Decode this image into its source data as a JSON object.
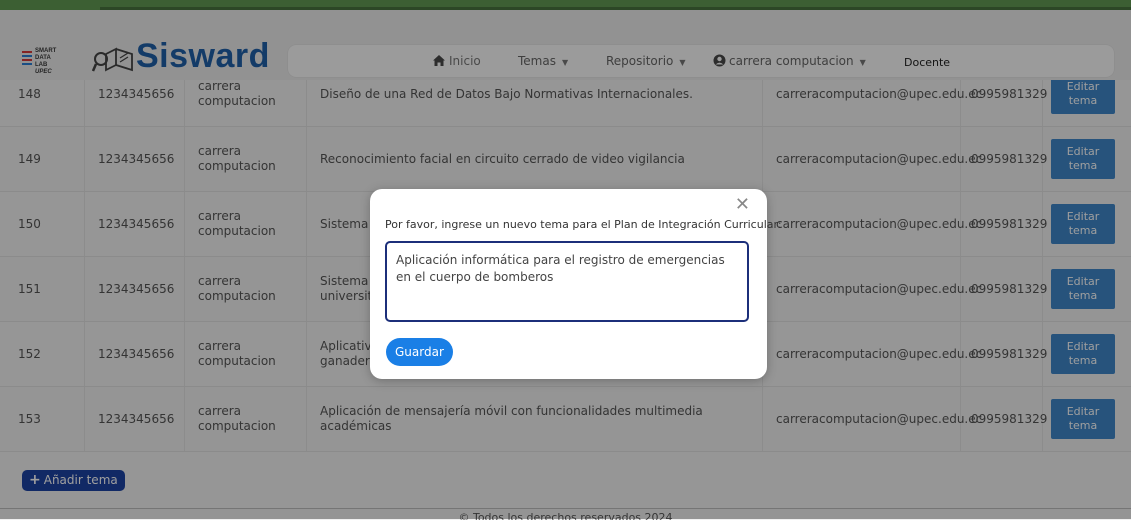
{
  "brand": {
    "logo_text_lines": [
      "SMART",
      "DATA LAB",
      "UPEC"
    ],
    "title": "Sisward"
  },
  "nav": {
    "home": "Inicio",
    "temas": "Temas",
    "repositorio": "Repositorio",
    "user": "carrera computacion",
    "role": "Docente",
    "icons": {
      "home": "home-icon",
      "user": "user-circle-icon",
      "dropdown": "caret-down-icon"
    }
  },
  "table": {
    "rows": [
      {
        "id": "148",
        "cedula": "1234345656",
        "carrera": "carrera computacion",
        "tema": "Diseño de una Red de Datos Bajo Normativas Internacionales.",
        "email": "carreracomputacion@upec.edu.ec",
        "telefono": "0995981329",
        "action": "Editar tema"
      },
      {
        "id": "149",
        "cedula": "1234345656",
        "carrera": "carrera computacion",
        "tema": "Reconocimiento facial en circuito cerrado de video vigilancia",
        "email": "carreracomputacion@upec.edu.ec",
        "telefono": "0995981329",
        "action": "Editar tema"
      },
      {
        "id": "150",
        "cedula": "1234345656",
        "carrera": "carrera computacion",
        "tema": "Sistema i",
        "email": "carreracomputacion@upec.edu.ec",
        "telefono": "0995981329",
        "action": "Editar tema"
      },
      {
        "id": "151",
        "cedula": "1234345656",
        "carrera": "carrera computacion",
        "tema": "Sistema i\nuniversita",
        "email": "carreracomputacion@upec.edu.ec",
        "telefono": "0995981329",
        "action": "Editar tema"
      },
      {
        "id": "152",
        "cedula": "1234345656",
        "carrera": "carrera computacion",
        "tema": "Aplicativo\nganadera",
        "email": "carreracomputacion@upec.edu.ec",
        "telefono": "0995981329",
        "action": "Editar tema"
      },
      {
        "id": "153",
        "cedula": "1234345656",
        "carrera": "carrera computacion",
        "tema": "Aplicación de mensajería móvil con funcionalidades multimedia académicas",
        "email": "carreracomputacion@upec.edu.ec",
        "telefono": "0995981329",
        "action": "Editar tema"
      }
    ],
    "add_button": "Añadir tema"
  },
  "footer": {
    "text": "© Todos los derechos reservados 2024"
  },
  "modal": {
    "label": "Por favor, ingrese un nuevo tema para el Plan de Integración Curricular:",
    "value": "Aplicación informática para el registro de emergencias en el cuerpo de bomberos",
    "save_button": "Guardar",
    "close_icon": "close-icon"
  },
  "colors": {
    "brand_blue": "#1f5fa8",
    "edit_button": "#3f87c9",
    "add_button": "#1c43a3",
    "save_button": "#1a7fe6",
    "textarea_border": "#1c2f7a",
    "header_strip": "#3c5f33"
  }
}
